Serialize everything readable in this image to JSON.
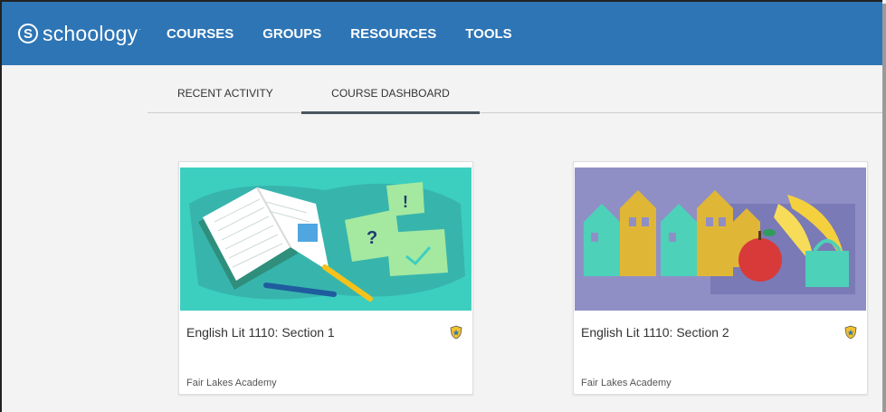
{
  "header": {
    "brand": "schoology",
    "brand_mark": "S",
    "nav": [
      "COURSES",
      "GROUPS",
      "RESOURCES",
      "TOOLS"
    ]
  },
  "tabs": [
    {
      "label": "RECENT ACTIVITY",
      "active": false
    },
    {
      "label": "COURSE DASHBOARD",
      "active": true
    }
  ],
  "courses": [
    {
      "title": "English Lit 1110: Section 1",
      "school": "Fair Lakes Academy",
      "badge_icon": "shield-star-icon"
    },
    {
      "title": "English Lit 1110: Section 2",
      "school": "Fair Lakes Academy",
      "badge_icon": "shield-star-icon"
    }
  ],
  "colors": {
    "header_bg": "#2e75b5",
    "page_bg": "#f3f3f3",
    "card1_bg": "#3ccfc0",
    "card2_bg": "#8f8fc6"
  }
}
